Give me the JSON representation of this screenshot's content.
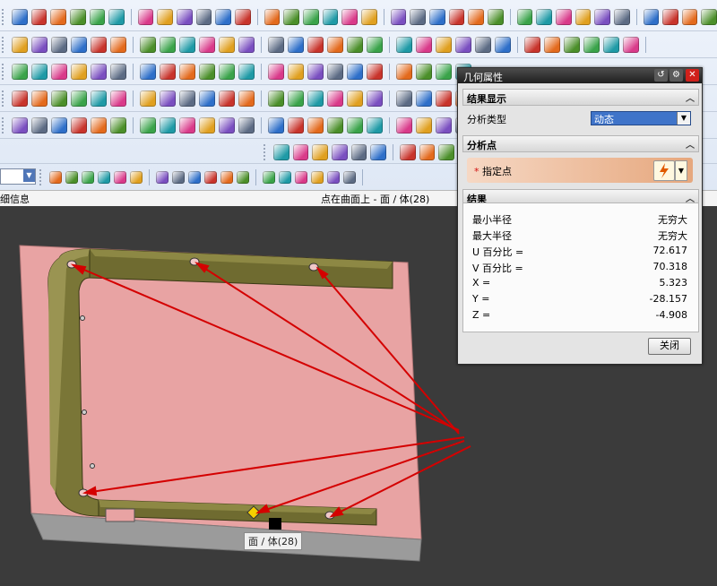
{
  "status": {
    "left": "细信息",
    "right": "点在曲面上 - 面 / 体(28)"
  },
  "dialog": {
    "title": "几何属性",
    "section_display": "结果显示",
    "analysis_type_label": "分析类型",
    "analysis_type_value": "动态",
    "section_point": "分析点",
    "specify_point_label": "指定点",
    "section_results": "结果",
    "results": [
      {
        "label": "最小半径",
        "value": "无穷大"
      },
      {
        "label": "最大半径",
        "value": "无穷大"
      },
      {
        "label": "U 百分比 =",
        "value": "72.617"
      },
      {
        "label": "V 百分比 =",
        "value": "70.318"
      },
      {
        "label": "X =",
        "value": "5.323"
      },
      {
        "label": "Y =",
        "value": "-28.157"
      },
      {
        "label": "Z =",
        "value": "-4.908"
      }
    ],
    "close_label": "关闭"
  },
  "tooltip": "面 / 体(28)",
  "colors": {
    "plate": "#e8a3a3",
    "rail": "#6e6a2e",
    "arrow": "#d40000",
    "viewport": "#3b3b3b"
  }
}
